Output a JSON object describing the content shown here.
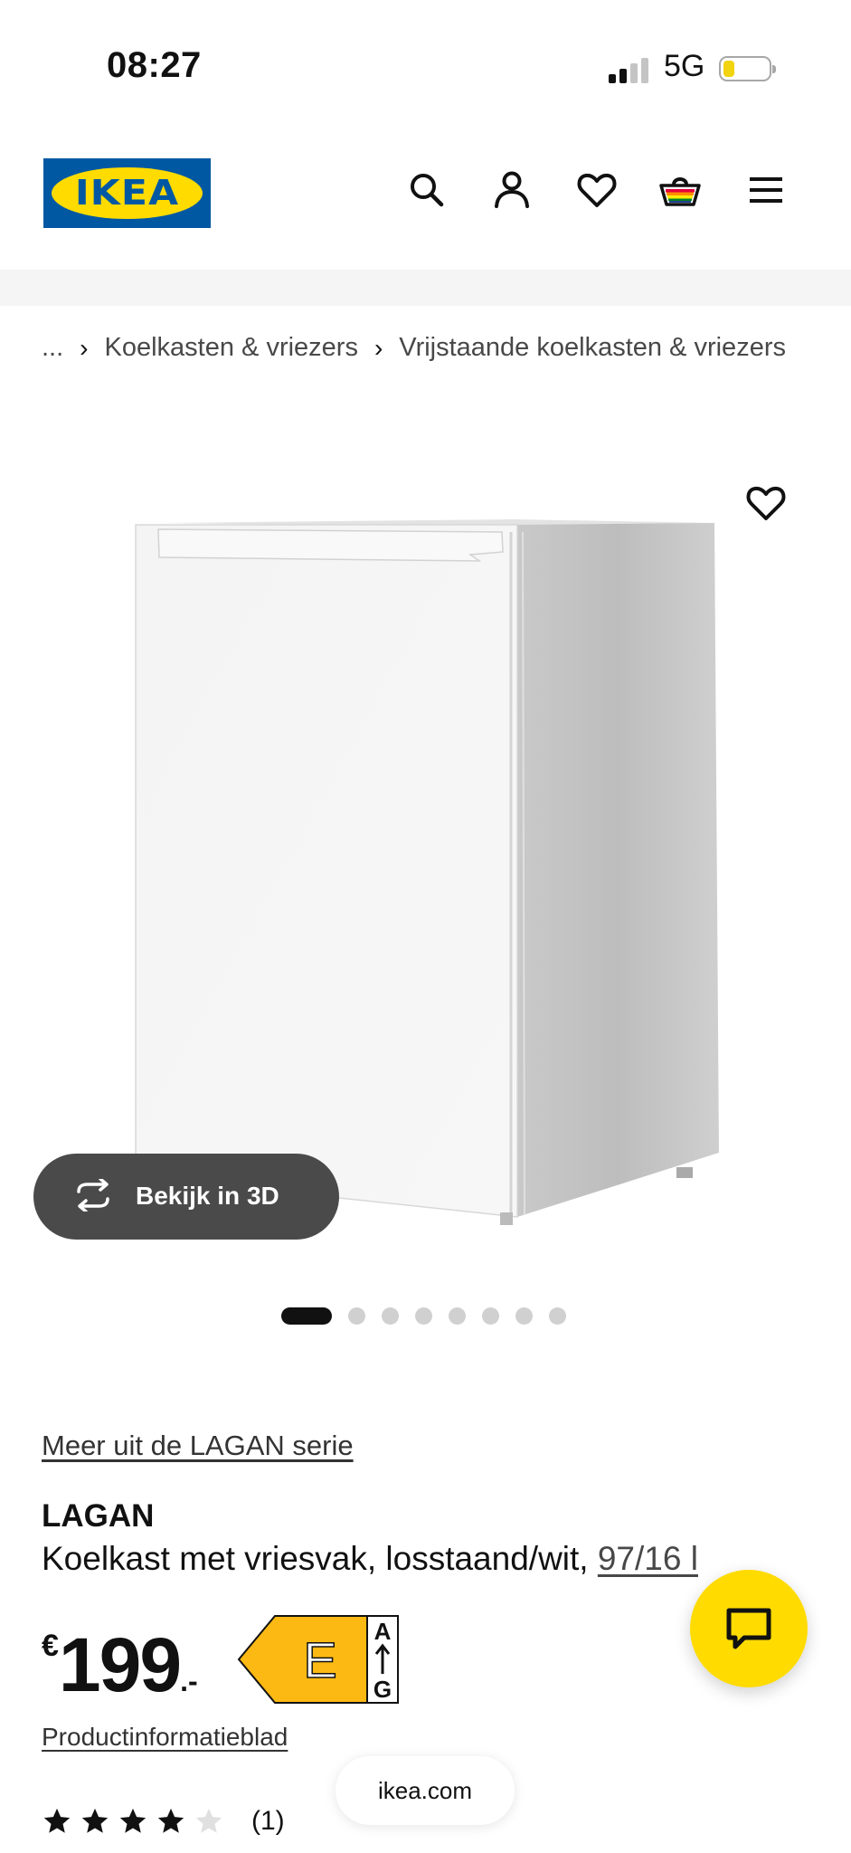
{
  "status_bar": {
    "time": "08:27",
    "network": "5G",
    "battery_level": 0.2
  },
  "header": {
    "logo_text": "IKEA",
    "icons": [
      "search-icon",
      "account-icon",
      "favorites-heart-icon",
      "shopping-bag-icon",
      "menu-icon"
    ]
  },
  "breadcrumb": {
    "items": [
      "...",
      "Koelkasten & vriezers",
      "Vrijstaande koelkasten & vriezers"
    ],
    "separator": "›"
  },
  "gallery": {
    "view_3d_label": "Bekijk in 3D",
    "slide_count": 8,
    "active_slide": 1
  },
  "product": {
    "series_link": "Meer uit de LAGAN serie",
    "name": "LAGAN",
    "description": "Koelkast met vriesvak, losstaand/wit, ",
    "dimension_link": "97/16 l",
    "price_currency": "€",
    "price_int": "199",
    "price_dec": ".-",
    "energy_class": "E",
    "energy_scale_top": "A",
    "energy_scale_bottom": "G",
    "info_sheet_link": "Productinformatieblad",
    "rating": 4,
    "rating_max": 5,
    "review_count": "(1)"
  },
  "browser": {
    "url": "ikea.com"
  },
  "colors": {
    "ikea_blue": "#0058a3",
    "ikea_yellow": "#ffdb00",
    "energy_orange": "#fdb913"
  }
}
